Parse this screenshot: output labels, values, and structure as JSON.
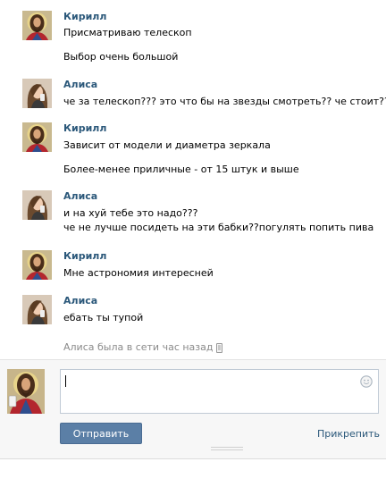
{
  "messages": [
    {
      "author": "Кирилл",
      "avatar": "jesus-avatar",
      "lines": [
        "Присматриваю телескоп",
        "Выбор очень большой"
      ]
    },
    {
      "author": "Алиса",
      "avatar": "girl-avatar",
      "lines": [
        "че за телескоп??? это что бы на звезды смотреть?? че стоит??"
      ]
    },
    {
      "author": "Кирилл",
      "avatar": "jesus-avatar",
      "lines": [
        "Зависит от модели и диаметра зеркала",
        "Более-менее приличные - от 15 штук и выше"
      ]
    },
    {
      "author": "Алиса",
      "avatar": "girl-avatar",
      "lines": [
        "и на хуй тебе это надо???",
        "че не лучше посидеть на эти бабки??погулять попить пива"
      ]
    },
    {
      "author": "Кирилл",
      "avatar": "jesus-avatar",
      "lines": [
        "Мне астрономия интересней"
      ]
    },
    {
      "author": "Алиса",
      "avatar": "girl-avatar",
      "lines": [
        "ебать ты тупой"
      ]
    }
  ],
  "status": {
    "text": "Алиса была в сети час назад",
    "icon": "phone-icon"
  },
  "compose": {
    "value": "",
    "send_label": "Отправить",
    "attach_label": "Прикрепить",
    "emoji_icon": "smile-icon"
  },
  "colors": {
    "name": "#2b587a",
    "button": "#5b7fa6",
    "link": "#2b587a",
    "status": "#8a8a8a"
  }
}
